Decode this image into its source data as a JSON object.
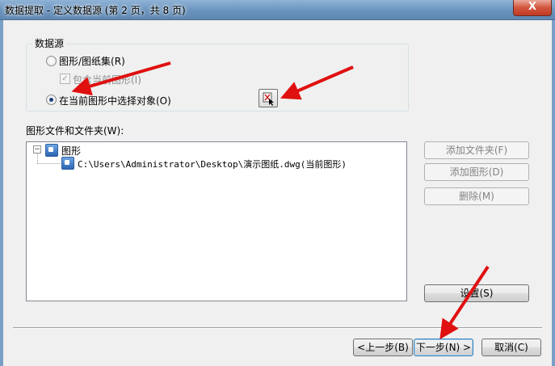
{
  "window": {
    "title": "数据提取 - 定义数据源 (第 2 页，共 8 页)",
    "close_label": "X"
  },
  "datasource": {
    "group_label": "数据源",
    "option_drawings": "图形/图纸集(R)",
    "include_current": "包含当前图形(I)",
    "option_select": "在当前图形中选择对象(O)"
  },
  "files": {
    "label": "图形文件和文件夹(W):",
    "root": "图形",
    "item": "C:\\Users\\Administrator\\Desktop\\演示图纸.dwg(当前图形)"
  },
  "side_buttons": {
    "add_folder": "添加文件夹(F)",
    "add_drawing": "添加图形(D)",
    "delete": "删除(M)",
    "settings": "设置(S)"
  },
  "nav": {
    "back": "<上一步(B)",
    "next": "下一步(N) >",
    "cancel": "取消(C)"
  },
  "colors": {
    "annotation_arrow": "#e01010"
  }
}
